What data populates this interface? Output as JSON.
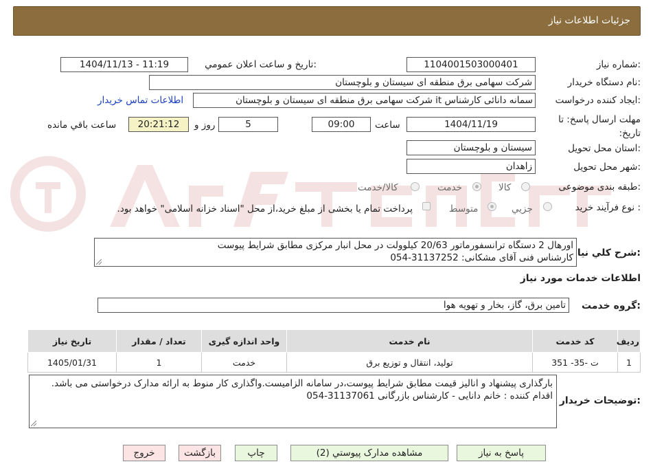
{
  "header": {
    "title": "جزئيات اطلاعات نياز"
  },
  "need_number": {
    "label": "شماره نياز:",
    "value": "1104001503000401"
  },
  "announce_datetime": {
    "label": "تاريخ و ساعت اعلان عمومي:",
    "value": "1404/11/13 - 11:19"
  },
  "buyer_org": {
    "label": "نام دستگاه خريدار:",
    "value": "شرکت سهامی برق منطقه ای سیستان و بلوچستان"
  },
  "requester": {
    "label": "ايجاد کننده درخواست:",
    "value": "سمانه دانائی کارشناس it شرکت سهامی برق منطقه ای سیستان و بلوچستان",
    "contact_link": "اطلاعات تماس خريدار"
  },
  "deadline": {
    "label": "مهلت ارسال پاسخ: تا تاريخ:",
    "date": "1404/11/19",
    "time_label": "ساعت",
    "time": "09:00",
    "days": "5",
    "days_label": "روز و",
    "remaining": "20:21:12",
    "remaining_label": "ساعت باقي مانده"
  },
  "province": {
    "label": "استان محل تحويل:",
    "value": "سیستان و بلوچستان"
  },
  "city": {
    "label": "شهر محل تحويل:",
    "value": "زاهدان"
  },
  "category": {
    "label": "طبقه بندی موضوعی:",
    "options": [
      "کالا",
      "خدمت",
      "کالا/خدمت"
    ],
    "selected": "خدمت"
  },
  "process_type": {
    "label": "نوع فرآيند خريد :",
    "options": [
      "جزيي",
      "متوسط"
    ],
    "selected": "متوسط",
    "payment_note": "پرداخت تمام يا بخشی از مبلغ خريد،از محل \"اسناد خزانه اسلامی\" خواهد بود."
  },
  "description": {
    "label": "شرح کلي نياز:",
    "line1": "اورهال 2 دستگاه ترانسفورماتور 20/63 کیلوولت در محل انبار مرکزی مطابق شرایط پیوست",
    "line2": "کارشناس فنی آقای مشکانی: 31137252-054"
  },
  "services_section": {
    "title": "اطلاعات خدمات مورد نياز"
  },
  "service_group": {
    "label": "گروه خدمت:",
    "value": "تامین برق، گاز، بخار و تهویه هوا"
  },
  "table": {
    "headers": [
      "رديف",
      "کد خدمت",
      "نام خدمت",
      "واحد اندازه گيری",
      "تعداد / مقدار",
      "تاريخ نياز"
    ],
    "rows": [
      [
        "1",
        "ت -35- 351",
        "تولید، انتقال و توزیع برق",
        "خدمت",
        "1",
        "1405/01/31"
      ]
    ]
  },
  "buyer_notes": {
    "label": "توضيحات خريدار:",
    "line1": "بارگذاری پیشنهاد و انالیز قیمت مطابق شرایط پیوست،در سامانه الزامیست.واگذاری کار منوط به ارائه مدارک درخواستی می باشد.",
    "line2": "اقدام کننده : خانم دانایی - کارشناس بازرگانی 31137061-054"
  },
  "buttons": {
    "reply": "پاسخ به نياز",
    "attachments": "مشاهده مدارک پيوستي (2)",
    "print": "چاپ",
    "back": "بازگشت",
    "exit": "خروج"
  },
  "colors": {
    "header_bg": "#8b6d3e",
    "link": "#1b3fbf",
    "remaining_bg": "#f5f2c6",
    "button_bg": "#e9f7df",
    "button_red_bg": "#fde4e4"
  }
}
